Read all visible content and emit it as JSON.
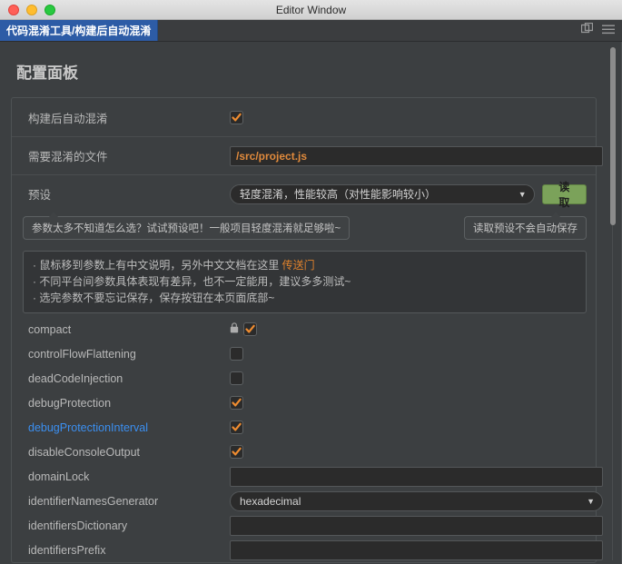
{
  "window": {
    "title": "Editor Window",
    "traffic_lights": [
      "close",
      "minimize",
      "zoom"
    ]
  },
  "tabbar": {
    "active_tab": "代码混淆工具/构建后自动混淆",
    "icons": [
      "duplicate-icon",
      "hamburger-menu-icon"
    ]
  },
  "page": {
    "title": "配置面板"
  },
  "settings": [
    {
      "label": "构建后自动混淆",
      "type": "checkbox",
      "checked": true,
      "locked": false
    },
    {
      "label": "需要混淆的文件",
      "type": "text",
      "value": "/src/project.js",
      "placeholder": ""
    },
    {
      "label": "预设",
      "type": "select-with-button",
      "value": "轻度混淆，性能较高（对性能影响较小）",
      "button_label": "读取"
    }
  ],
  "tooltips": {
    "left": "参数太多不知道怎么选？试试预设吧！一般项目轻度混淆就足够啦~",
    "right": "读取预设不会自动保存"
  },
  "infobox": {
    "lines": [
      {
        "text": "· 鼠标移到参数上有中文说明，另外中文文档在这里 ",
        "link": "传送门"
      },
      {
        "text": "· 不同平台间参数具体表现有差异，也不一定能用，建议多多测试~",
        "link": ""
      },
      {
        "text": "· 选完参数不要忘记保存，保存按钮在本页面底部~",
        "link": ""
      }
    ]
  },
  "options": [
    {
      "label": "compact",
      "type": "checkbox",
      "checked": true,
      "locked": true,
      "highlight": false
    },
    {
      "label": "controlFlowFlattening",
      "type": "checkbox",
      "checked": false,
      "locked": false,
      "highlight": false
    },
    {
      "label": "deadCodeInjection",
      "type": "checkbox",
      "checked": false,
      "locked": false,
      "highlight": false
    },
    {
      "label": "debugProtection",
      "type": "checkbox",
      "checked": true,
      "locked": false,
      "highlight": false
    },
    {
      "label": "debugProtectionInterval",
      "type": "checkbox",
      "checked": true,
      "locked": false,
      "highlight": true
    },
    {
      "label": "disableConsoleOutput",
      "type": "checkbox",
      "checked": true,
      "locked": false,
      "highlight": false
    },
    {
      "label": "domainLock",
      "type": "text",
      "value": "",
      "highlight": false
    },
    {
      "label": "identifierNamesGenerator",
      "type": "select",
      "value": "hexadecimal",
      "highlight": false
    },
    {
      "label": "identifiersDictionary",
      "type": "text",
      "value": "",
      "highlight": false
    },
    {
      "label": "identifiersPrefix",
      "type": "text",
      "value": "",
      "highlight": false
    }
  ],
  "colors": {
    "accent_orange": "#e08a3c",
    "link_blue": "#3b8ff0",
    "button_green": "#7ba25a",
    "tab_blue": "#2d5ca6",
    "panel_bg": "#3c3f41",
    "input_bg": "#2b2b2b"
  },
  "scroll": {
    "position_pct": 0
  }
}
